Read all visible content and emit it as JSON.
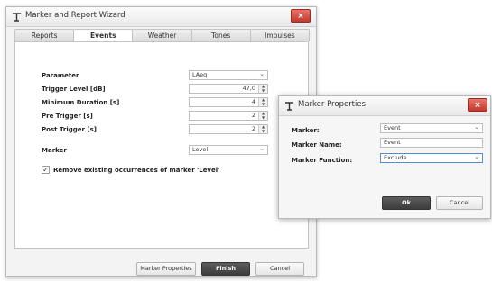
{
  "wizard": {
    "title": "Marker and Report Wizard",
    "close": "×",
    "tabs": [
      {
        "label": "Reports",
        "active": false
      },
      {
        "label": "Events",
        "active": true
      },
      {
        "label": "Weather",
        "active": false
      },
      {
        "label": "Tones",
        "active": false
      },
      {
        "label": "Impulses",
        "active": false
      }
    ],
    "parameter_label": "Parameter",
    "parameter_value": "LAeq",
    "trigger_level_label": "Trigger Level [dB]",
    "trigger_level_value": "47,0",
    "min_duration_label": "Minimum Duration [s]",
    "min_duration_value": "4",
    "pre_trigger_label": "Pre Trigger [s]",
    "pre_trigger_value": "2",
    "post_trigger_label": "Post Trigger [s]",
    "post_trigger_value": "2",
    "marker_label": "Marker",
    "marker_value": "Level",
    "remove_label": "Remove existing occurrences of marker 'Level'",
    "remove_checked": true,
    "marker_properties_button": "Marker Properties",
    "finish_button": "Finish",
    "cancel_button": "Cancel"
  },
  "props": {
    "title": "Marker Properties",
    "close": "×",
    "marker_label": "Marker:",
    "marker_value": "Event",
    "name_label": "Marker Name:",
    "name_value": "Event",
    "function_label": "Marker Function:",
    "function_value": "Exclude",
    "ok_button": "Ok",
    "cancel_button": "Cancel"
  },
  "icons": {
    "title_icon": "wand-icon",
    "dropdown": "chevron-down-icon",
    "spinner": "spinner-arrows-icon",
    "checkmark": "check-icon"
  },
  "colors": {
    "close_button": "#c23a2e",
    "primary_button": "#4a4a4a",
    "focus_border": "#4d8fd6"
  }
}
